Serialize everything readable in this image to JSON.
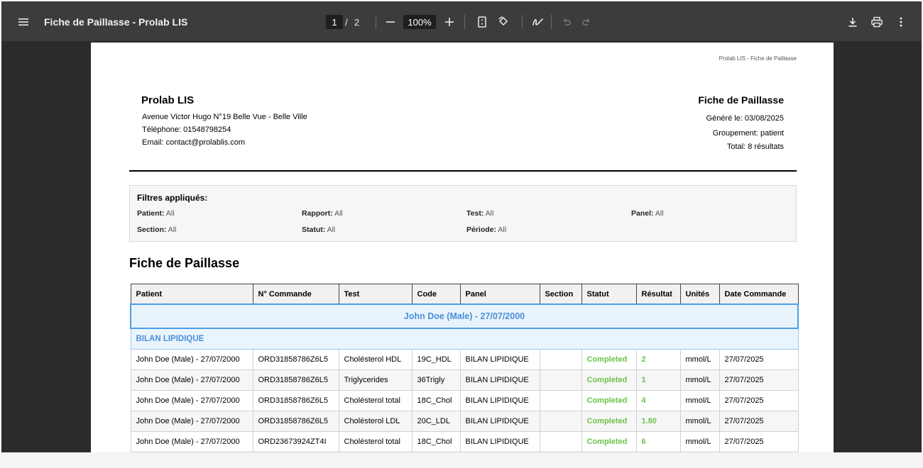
{
  "toolbar": {
    "title": "Fiche de Paillasse - Prolab LIS",
    "current_page": "1",
    "page_separator": "/",
    "total_pages": "2",
    "zoom": "100%",
    "icons": [
      "menu-icon",
      "zoom-out-icon",
      "zoom-in-icon",
      "fit-page-icon",
      "rotate-icon",
      "draw-icon",
      "undo-icon",
      "redo-icon",
      "download-icon",
      "print-icon",
      "more-vert-icon"
    ]
  },
  "document": {
    "running_header": "Prolab LIS - Fiche de Paillasse",
    "lab": {
      "name": "Prolab LIS",
      "address": "Avenue Victor Hugo N°19 Belle Vue - Belle Ville",
      "phone": "Téléphone: 01548798254",
      "email": "Email: contact@prolablis.com"
    },
    "meta": {
      "title": "Fiche de Paillasse",
      "generated": "Généré le: 03/08/2025",
      "grouping": "Groupement: patient",
      "total": "Total: 8 résultats"
    },
    "filters": {
      "title": "Filtres appliqués:",
      "items": [
        {
          "label": "Patient:",
          "value": "All"
        },
        {
          "label": "Rapport:",
          "value": "All"
        },
        {
          "label": "Test:",
          "value": "All"
        },
        {
          "label": "Panel:",
          "value": "All"
        },
        {
          "label": "Section:",
          "value": "All"
        },
        {
          "label": "Statut:",
          "value": "All"
        },
        {
          "label": "Période:",
          "value": "All"
        }
      ]
    },
    "section_heading": "Fiche de Paillasse",
    "table": {
      "columns": [
        "Patient",
        "N° Commande",
        "Test",
        "Code",
        "Panel",
        "Section",
        "Statut",
        "Résultat",
        "Unités",
        "Date Commande"
      ],
      "group_label": "John Doe (Male) - 27/07/2000",
      "panel_label": "BILAN LIPIDIQUE",
      "rows": [
        [
          "John Doe (Male) - 27/07/2000",
          "ORD31858786Z6L5",
          "Cholésterol HDL",
          "19C_HDL",
          "BILAN LIPIDIQUE",
          "",
          "Completed",
          "2",
          "mmol/L",
          "27/07/2025"
        ],
        [
          "John Doe (Male) - 27/07/2000",
          "ORD31858786Z6L5",
          "Triglycerides",
          "36Trigly",
          "BILAN LIPIDIQUE",
          "",
          "Completed",
          "1",
          "mmol/L",
          "27/07/2025"
        ],
        [
          "John Doe (Male) - 27/07/2000",
          "ORD31858786Z6L5",
          "Cholésterol total",
          "18C_Chol",
          "BILAN LIPIDIQUE",
          "",
          "Completed",
          "4",
          "mmol/L",
          "27/07/2025"
        ],
        [
          "John Doe (Male) - 27/07/2000",
          "ORD31858786Z6L5",
          "Cholésterol LDL",
          "20C_LDL",
          "BILAN LIPIDIQUE",
          "",
          "Completed",
          "1.80",
          "mmol/L",
          "27/07/2025"
        ],
        [
          "John Doe (Male) - 27/07/2000",
          "ORD23673924ZT4I",
          "Cholésterol total",
          "18C_Chol",
          "BILAN LIPIDIQUE",
          "",
          "Completed",
          "6",
          "mmol/L",
          "27/07/2025"
        ]
      ]
    }
  },
  "colors": {
    "toolbar_bg": "#3c3c3c",
    "viewer_bg": "#2b2b2b",
    "group_accent": "#4a90d9",
    "status_green": "#6cc24a"
  }
}
